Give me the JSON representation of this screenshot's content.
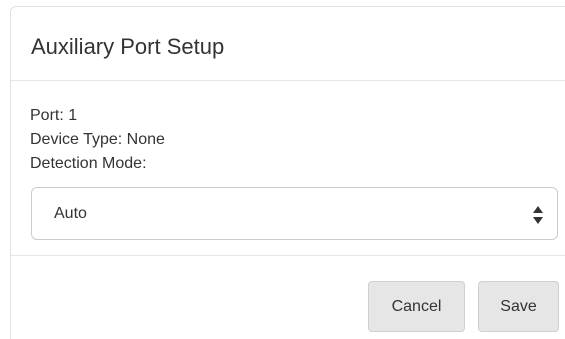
{
  "dialog": {
    "title": "Auxiliary Port Setup",
    "port_line": "Port: 1",
    "device_type_line": "Device Type: None",
    "detection_mode_label": "Detection Mode:",
    "detection_mode_value": "Auto",
    "cancel_label": "Cancel",
    "save_label": "Save"
  },
  "colors": {
    "text": "#333333",
    "button_bg": "#e6e6e6",
    "border": "#cccccc",
    "divider": "#e5e5e5"
  },
  "icons": {
    "select": "up-down-arrows-icon"
  }
}
